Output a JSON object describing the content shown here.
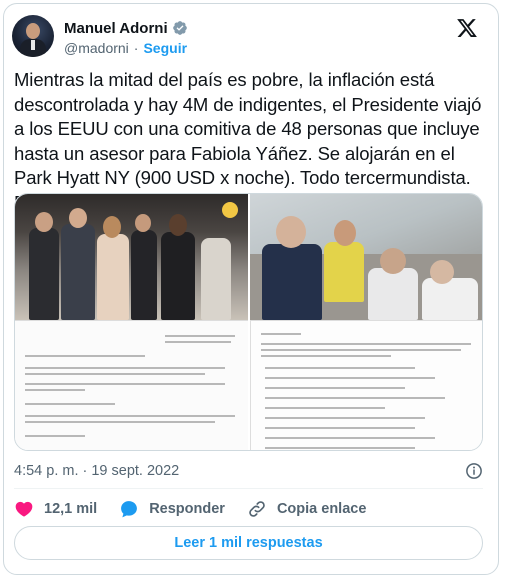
{
  "author": {
    "name": "Manuel Adorni",
    "handle": "@madorni",
    "separator": "·",
    "follow_label": "Seguir"
  },
  "icons": {
    "verified": "verified-badge-icon",
    "logo": "x-logo-icon",
    "info": "info-icon",
    "like": "heart-icon",
    "reply": "speech-bubble-icon",
    "copy": "link-icon"
  },
  "colors": {
    "accent": "#1d9bf0",
    "like": "#f91880",
    "text": "#0f1419",
    "muted": "#536471",
    "border": "#cfd9de"
  },
  "tweet": {
    "text": "Mientras la mitad del país es pobre, la inflación está descontrolada y hay 4M de indigentes, el Presidente viajó a los EEUU con una comitiva de 48 personas que incluye hasta un asesor para Fabiola Yáñez. Se alojarán en el Park Hyatt NY (900 USD x noche). Todo tercermundista. Fin.",
    "timestamp": "4:54 p. m. · 19 sept. 2022"
  },
  "actions": {
    "likes_count": "12,1 mil",
    "reply_label": "Responder",
    "copy_label": "Copia enlace"
  },
  "replies_button": {
    "label": "Leer 1 mil respuestas"
  }
}
